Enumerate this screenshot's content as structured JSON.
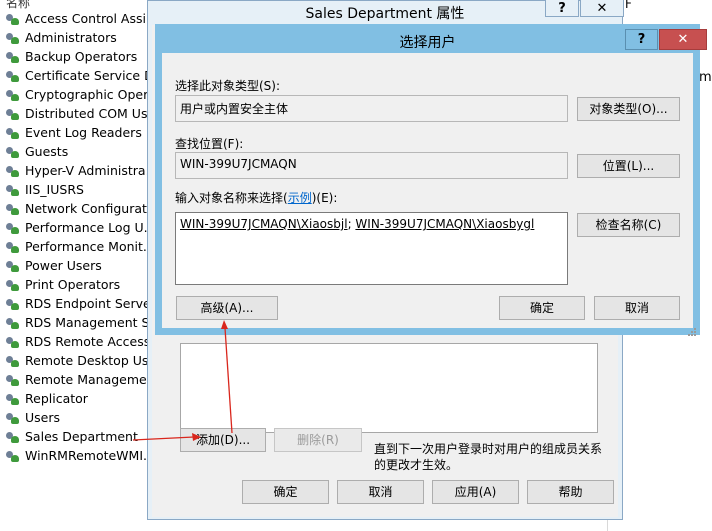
{
  "left_list": {
    "header": "名称",
    "groups": [
      "Access Control Assi...",
      "Administrators",
      "Backup Operators",
      "Certificate Service D...",
      "Cryptographic Oper...",
      "Distributed COM Us...",
      "Event Log Readers",
      "Guests",
      "Hyper-V Administra...",
      "IIS_IUSRS",
      "Network Configurat...",
      "Performance Log U...",
      "Performance Monit...",
      "Power Users",
      "Print Operators",
      "RDS Endpoint Serve...",
      "RDS Management S...",
      "RDS Remote Access...",
      "Remote Desktop Us...",
      "Remote Manageme...",
      "Replicator",
      "Users",
      "Sales Department",
      "WinRMRemoteWMI..."
    ]
  },
  "right_strip": {
    "text_f": "F",
    "text_m": "m"
  },
  "properties_dialog": {
    "title": "Sales Department 属性",
    "help_label": "?",
    "close_label": "✕",
    "add_button": "添加(D)...",
    "remove_button": "删除(R)",
    "note": "直到下一次用户登录时对用户的组成员关系的更改才生效。",
    "ok_button": "确定",
    "cancel_button": "取消",
    "apply_button": "应用(A)",
    "help_button": "帮助"
  },
  "select_users_dialog": {
    "title": "选择用户",
    "help_label": "?",
    "close_label": "✕",
    "object_type_label": "选择此对象类型(S):",
    "object_type_value": "用户或内置安全主体",
    "object_types_button": "对象类型(O)...",
    "location_label": "查找位置(F):",
    "location_value": "WIN-399U7JCMAQN",
    "locations_button": "位置(L)...",
    "enter_names_label_pre": "输入对象名称来选择(",
    "enter_names_link": "示例",
    "enter_names_label_post": ")(E):",
    "names_value_1": "WIN-399U7JCMAQN\\Xiaosbjl",
    "names_sep": "; ",
    "names_value_2": "WIN-399U7JCMAQN\\Xiaosbygl",
    "check_names_button": "检查名称(C)",
    "advanced_button": "高级(A)...",
    "ok_button": "确定",
    "cancel_button": "取消"
  },
  "annotation_color": "#d9261c"
}
